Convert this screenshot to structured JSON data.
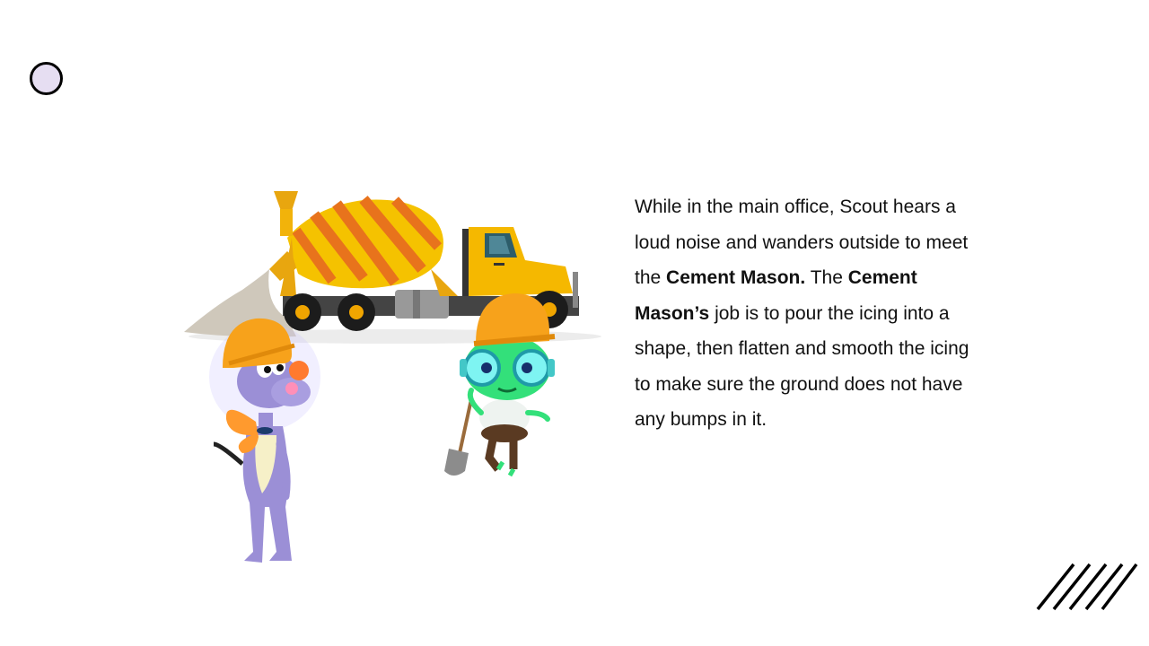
{
  "slide": {
    "paragraph": {
      "part1": "While in the main office, Scout hears a loud noise and wanders outside to meet the ",
      "bold1": "Cement Mason.",
      "part2": " The ",
      "bold2": "Cement Mason’s",
      "part3": " job is to pour the icing into a shape, then flatten and smooth the icing to make sure the ground does not have any bumps in it."
    }
  },
  "illustration": {
    "truck_color": "#f5b800",
    "drum_stripe_color": "#e8731c",
    "hardhat_color": "#f7a21b",
    "dog_color": "#9b8fd6",
    "alien_color": "#33e07a",
    "icons": [
      "cement-mixer-truck",
      "purple-dog-character",
      "green-alien-character",
      "shovel"
    ]
  },
  "decorations": {
    "circle_fill": "#e6def2",
    "hatch_color": "#000000"
  }
}
